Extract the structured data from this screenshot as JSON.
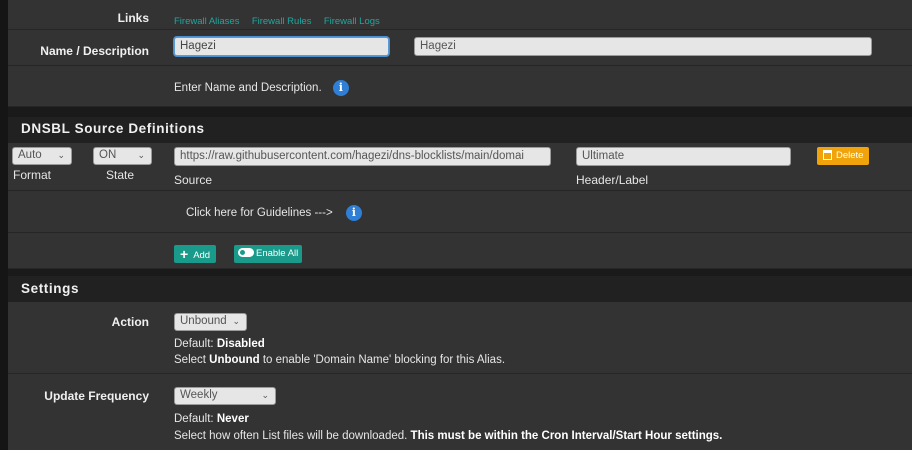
{
  "links": {
    "label": "Links",
    "items": [
      "Firewall Aliases",
      "Firewall Rules",
      "Firewall Logs"
    ]
  },
  "name_desc": {
    "label": "Name / Description",
    "name_value": "Hagezi",
    "desc_value": "Hagezi",
    "help": "Enter Name and Description."
  },
  "dnsbl": {
    "heading": "DNSBL Source Definitions",
    "format_value": "Auto",
    "format_label": "Format",
    "state_value": "ON",
    "state_label": "State",
    "source_value": "https://raw.githubusercontent.com/hagezi/dns-blocklists/main/domai",
    "source_label": "Source",
    "header_value": "Ultimate",
    "header_label": "Header/Label",
    "delete_label": "Delete",
    "guidelines_text": "Click here for Guidelines --->",
    "add_label": "Add",
    "enable_all_label": "Enable All"
  },
  "settings": {
    "heading": "Settings",
    "action": {
      "label": "Action",
      "value": "Unbound",
      "default_prefix": "Default:",
      "default_value": "Disabled",
      "help_prefix": "Select",
      "help_bold": "Unbound",
      "help_suffix": "to enable 'Domain Name' blocking for this Alias."
    },
    "update": {
      "label": "Update Frequency",
      "value": "Weekly",
      "default_prefix": "Default:",
      "default_value": "Never",
      "help_text": "Select how often List files will be downloaded.",
      "help_bold": "This must be within the Cron Interval/Start Hour settings."
    }
  },
  "icons": {
    "info": "info-icon",
    "chevron": "chevron-down-icon",
    "plus": "plus-icon",
    "toggle": "toggle-icon",
    "trash": "trash-icon"
  },
  "colors": {
    "accent_green": "#1a9a8a",
    "link": "#1ea8a0",
    "delete_orange": "#f0a30a",
    "info_blue": "#2f7fd6"
  }
}
